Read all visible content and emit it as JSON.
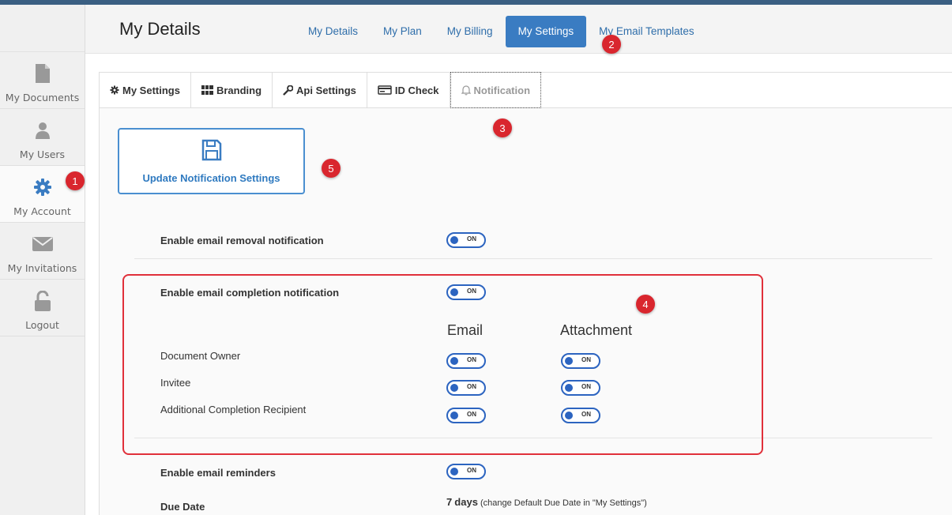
{
  "header": {
    "title": "My Details",
    "nav": [
      "My Details",
      "My Plan",
      "My Billing",
      "My Settings",
      "My Email Templates"
    ]
  },
  "sidebar": {
    "items": [
      {
        "label": "My Documents",
        "icon": "document-icon"
      },
      {
        "label": "My Users",
        "icon": "user-icon"
      },
      {
        "label": "My Account",
        "icon": "gear-icon"
      },
      {
        "label": "My Invitations",
        "icon": "envelope-icon"
      },
      {
        "label": "Logout",
        "icon": "unlock-icon"
      }
    ]
  },
  "tabs": [
    {
      "label": "My Settings",
      "icon": "gear-icon"
    },
    {
      "label": "Branding",
      "icon": "grid-icon"
    },
    {
      "label": "Api Settings",
      "icon": "wrench-icon"
    },
    {
      "label": "ID Check",
      "icon": "id-card-icon"
    },
    {
      "label": "Notification",
      "icon": "bell-icon"
    }
  ],
  "update_button": {
    "label": "Update Notification Settings"
  },
  "settings": {
    "removal": {
      "label": "Enable email removal notification",
      "toggle": "ON"
    },
    "completion": {
      "label": "Enable email completion notification",
      "toggle": "ON"
    },
    "columns": {
      "email": "Email",
      "attachment": "Attachment"
    },
    "recipients": [
      {
        "label": "Document Owner",
        "email": "ON",
        "attachment": "ON"
      },
      {
        "label": "Invitee",
        "email": "ON",
        "attachment": "ON"
      },
      {
        "label": "Additional Completion Recipient",
        "email": "ON",
        "attachment": "ON"
      }
    ],
    "reminders": {
      "label": "Enable email reminders",
      "toggle": "ON"
    },
    "due_date": {
      "label": "Due Date",
      "value": "7",
      "unit": "days",
      "note": "(change Default Due Date in \"My Settings\")"
    }
  },
  "badges": [
    "1",
    "2",
    "3",
    "4",
    "5"
  ],
  "colors": {
    "accent": "#3a7cc2",
    "toggle": "#2c64c0",
    "annotation": "#d9262e"
  }
}
